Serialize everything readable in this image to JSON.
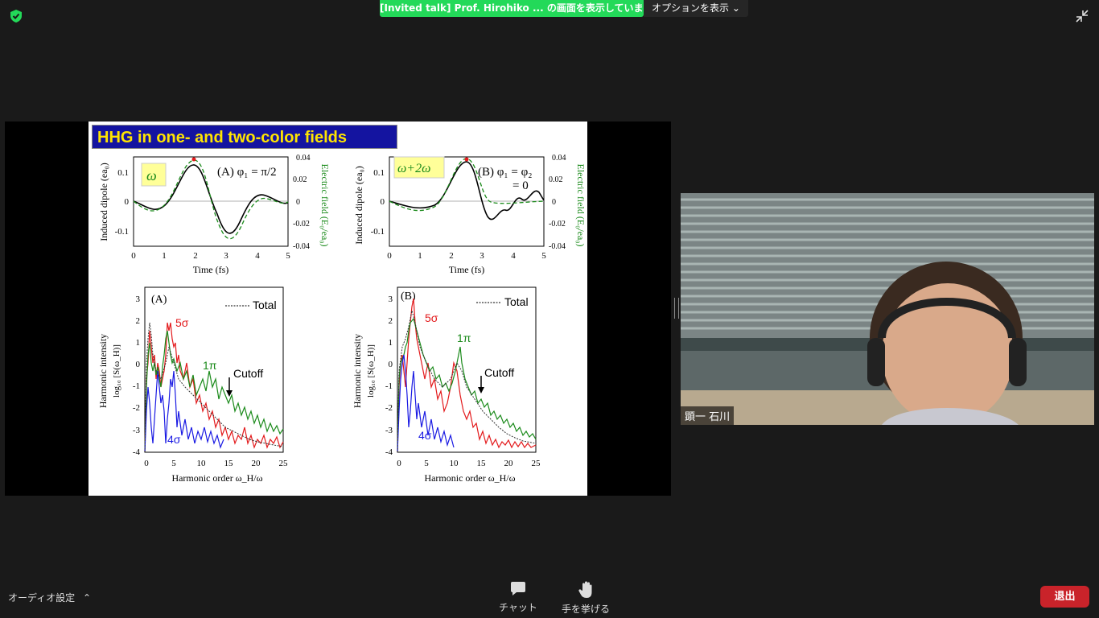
{
  "top_bar": {
    "share_banner_text": "[Invited talk] Prof. Hirohiko ... の画面を表示しています",
    "options_label": "オプションを表示",
    "icons": [
      "shield-check-icon",
      "exit-fullscreen-icon"
    ],
    "colors": {
      "banner": "#23d959",
      "shield": "#23d959"
    }
  },
  "slide": {
    "title": "HHG in one- and two-color fields",
    "top_left": {
      "badge": "ω",
      "label": "(A) φ₁ = π/2",
      "ylabel": "Induced dipole (ea₀)",
      "y2label": "Electric field (E₀/ea₀)",
      "xlabel": "Time (fs)",
      "xticks": [
        "0",
        "1",
        "2",
        "3",
        "4",
        "5"
      ],
      "yticks": [
        "0.1",
        "0",
        "-0.1"
      ],
      "y2ticks": [
        "0.04",
        "0.02",
        "0",
        "-0.02",
        "-0.04"
      ]
    },
    "top_right": {
      "badge": "ω+2ω",
      "label1": "(B) φ₁ = φ₂",
      "label2": "= 0",
      "ylabel": "Induced dipole (ea₀)",
      "y2label": "Electric field (E₀/ea₀)",
      "xlabel": "Time (fs)",
      "xticks": [
        "0",
        "1",
        "2",
        "3",
        "4",
        "5"
      ],
      "yticks": [
        "0.1",
        "0",
        "-0.1"
      ],
      "y2ticks": [
        "0.04",
        "0.02",
        "0",
        "-0.02",
        "-0.04"
      ]
    },
    "bottom_left": {
      "panel": "(A)",
      "legend": "Total",
      "l5": "5σ",
      "l1": "1π",
      "l4": "4σ",
      "cutoff": "Cutoff",
      "ylabel1": "Harmonic intensity",
      "ylabel2": "log₁₀ [S(ω_H)]",
      "xlabel": "Harmonic order ω_H/ω",
      "xticks": [
        "0",
        "5",
        "10",
        "15",
        "20",
        "25"
      ],
      "yticks": [
        "3",
        "2",
        "1",
        "0",
        "-1",
        "-2",
        "-3",
        "-4"
      ]
    },
    "bottom_right": {
      "panel": "(B)",
      "legend": "Total",
      "l5": "5σ",
      "l1": "1π",
      "l4": "4σ",
      "cutoff": "Cutoff",
      "ylabel1": "Harmonic intensity",
      "ylabel2": "log₁₀ [S(ω_H)]",
      "xlabel": "Harmonic order ω_H/ω",
      "xticks": [
        "0",
        "5",
        "10",
        "15",
        "20",
        "25"
      ],
      "yticks": [
        "3",
        "2",
        "1",
        "0",
        "-1",
        "-2",
        "-3",
        "-4"
      ]
    },
    "colors": {
      "title_bg": "#1414a0",
      "title_text": "#ffe500",
      "badge_bg": "#ffff99",
      "red": "#e31a1c",
      "green": "#1a8a1a",
      "blue": "#1a1ae3"
    }
  },
  "video": {
    "participant_name": "顕一 石川"
  },
  "bottom_bar": {
    "audio_settings": "オーディオ設定",
    "chat": "チャット",
    "raise_hand": "手を挙げる",
    "leave": "退出",
    "icons": [
      "chevron-up-icon",
      "chat-bubble-icon",
      "raise-hand-icon"
    ],
    "colors": {
      "leave": "#c9232a"
    }
  }
}
